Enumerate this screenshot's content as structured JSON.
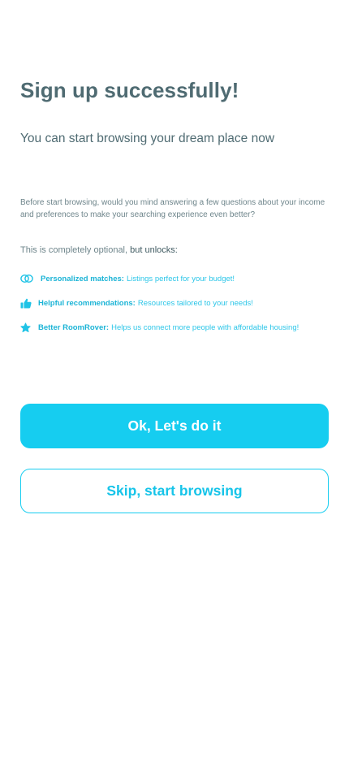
{
  "header": {
    "title": "Sign up successfully!",
    "subtitle": "You can start browsing your dream place now"
  },
  "intro": {
    "text": "Before start browsing, would you mind answering a few questions about your income and preferences to make your searching experience even better?"
  },
  "optional": {
    "prefix": "This is completely optional, ",
    "emphasis": "but unlocks:"
  },
  "benefits": [
    {
      "icon": "link-icon",
      "label": "Personalized matches:",
      "description": "Listings perfect for your budget!"
    },
    {
      "icon": "thumbs-up-icon",
      "label": "Helpful recommendations:",
      "description": "Resources tailored to your needs!"
    },
    {
      "icon": "star-icon",
      "label": "Better RoomRover:",
      "description": "Helps us connect more people with affordable housing!"
    }
  ],
  "actions": {
    "primary_label": "Ok, Let's do it",
    "secondary_label": "Skip, start browsing"
  },
  "colors": {
    "accent": "#16cdf0",
    "text": "#4f6b72",
    "background": "#ffffff"
  }
}
